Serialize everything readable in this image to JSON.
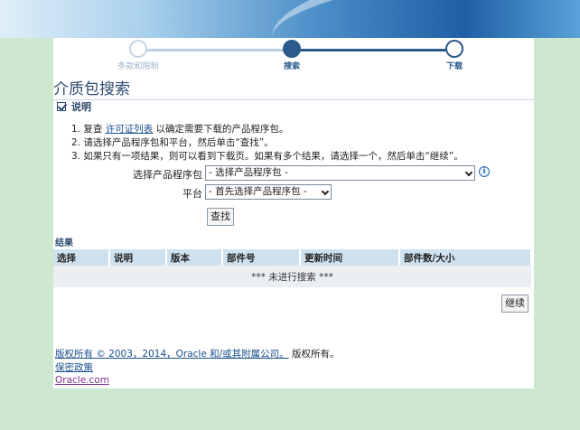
{
  "train": {
    "steps": [
      {
        "label": "条款和限制",
        "state": "done"
      },
      {
        "label": "搜索",
        "state": "current"
      },
      {
        "label": "下载",
        "state": "next"
      }
    ]
  },
  "page": {
    "title": "介质包搜索"
  },
  "instructions": {
    "heading": "说明",
    "step1_prefix": "1.  复查 ",
    "step1_link": "许可证列表",
    "step1_suffix": " 以确定需要下载的产品程序包。",
    "step2": "2.  请选择产品程序包和平台，然后单击“查找”。",
    "step3": "3.  如果只有一项结果，则可以看到下载页。如果有多个结果，请选择一个，然后单击“继续”。"
  },
  "form": {
    "product_label": "选择产品程序包",
    "product_value": "- 选择产品程序包 -",
    "platform_label": "平台",
    "platform_value": "- 首先选择产品程序包 -",
    "find_button": "查找"
  },
  "results": {
    "label": "结果",
    "columns": [
      "选择",
      "说明",
      "版本",
      "部件号",
      "更新时间",
      "部件数/大小"
    ],
    "empty_message": "*** 未进行搜索 ***",
    "continue_button": "继续"
  },
  "footer": {
    "copyright_link": "版权所有 © 2003，2014，Oracle 和/或其附属公司。",
    "copyright_suffix": " 版权所有。",
    "privacy_link": "保密政策",
    "oracle_link": "Oracle.com"
  }
}
